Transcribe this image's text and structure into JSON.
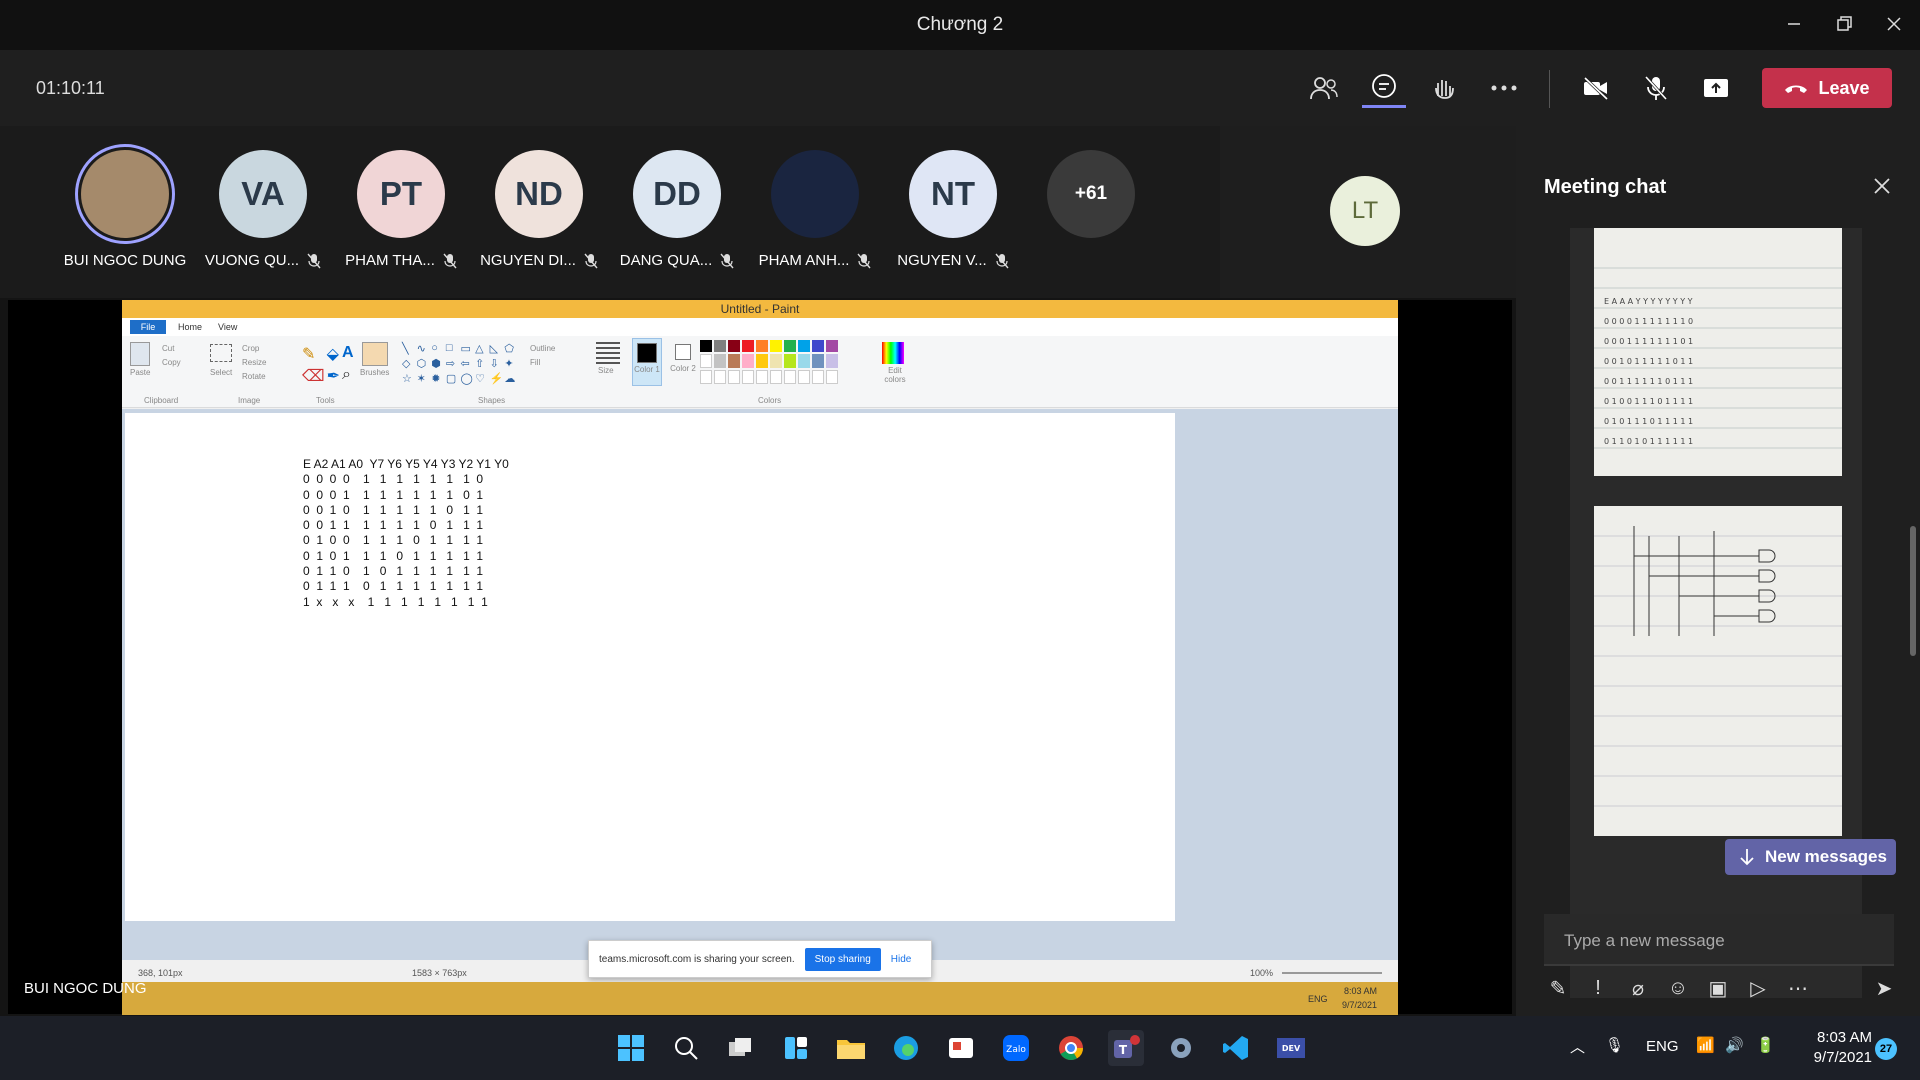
{
  "window": {
    "title": "Chương 2"
  },
  "meeting": {
    "timer": "01:10:11",
    "leave_label": "Leave",
    "presenter_name": "BUI NGOC DUNG"
  },
  "participants": [
    {
      "initials": "",
      "name": "BUI NGOC DUNG",
      "color": "#a58a6b",
      "photo": true
    },
    {
      "initials": "VA",
      "name": "VUONG QU...",
      "color": "#c9d7df"
    },
    {
      "initials": "PT",
      "name": "PHAM THA...",
      "color": "#f0d5d6"
    },
    {
      "initials": "ND",
      "name": "NGUYEN DI...",
      "color": "#efe2dc"
    },
    {
      "initials": "DD",
      "name": "DANG QUA...",
      "color": "#dde7f2"
    },
    {
      "initials": "",
      "name": "PHAM ANH...",
      "color": "#1a2540",
      "photo": true
    },
    {
      "initials": "NT",
      "name": "NGUYEN V...",
      "color": "#dfe6f5"
    },
    {
      "initials": "+61",
      "name": "",
      "color": "#3a3a3a"
    }
  ],
  "extra_participant": {
    "initials": "LT",
    "color": "#eaf0dc"
  },
  "paint": {
    "title": "Untitled - Paint",
    "tabs": [
      "File",
      "Home",
      "View"
    ],
    "groups": [
      "Clipboard",
      "Image",
      "Tools",
      "Shapes",
      "Colors"
    ],
    "tools": [
      "Paste",
      "Cut",
      "Copy",
      "Select",
      "Crop",
      "Resize",
      "Rotate",
      "Brushes",
      "Outline",
      "Fill",
      "Size",
      "Color 1",
      "Color 2",
      "Edit colors"
    ],
    "table_header": "E A2 A1 A0  Y7 Y6 Y5 Y4 Y3 Y2 Y1 Y0",
    "table_rows": [
      "0  0  0  0    1   1   1   1   1   1   1  0",
      "0  0  0  1    1   1   1   1   1   1   0  1",
      "0  0  1  0    1   1   1   1   1   0   1  1",
      "0  0  1  1    1   1   1   1   0   1   1  1",
      "0  1  0  0    1   1   1   0   1   1   1  1",
      "0  1  0  1    1   1   0   1   1   1   1  1",
      "0  1  1  0    1   0   1   1   1   1   1  1",
      "0  1  1  1    0   1   1   1   1   1   1  1",
      "1  x   x   x    1   1   1   1   1   1   1  1"
    ],
    "status_pos": "368, 101px",
    "status_size": "1583 × 763px",
    "zoom": "100%",
    "inner_clock": "8:03 AM",
    "inner_date": "9/7/2021",
    "inner_lang": "ENG"
  },
  "share_bar": {
    "text": "teams.microsoft.com is sharing your screen.",
    "stop_label": "Stop sharing",
    "hide_label": "Hide"
  },
  "chat": {
    "title": "Meeting chat",
    "new_messages_label": "New messages",
    "input_placeholder": "Type a new message"
  },
  "taskbar": {
    "lang": "ENG",
    "time": "8:03 AM",
    "date": "9/7/2021",
    "badge": "27"
  }
}
